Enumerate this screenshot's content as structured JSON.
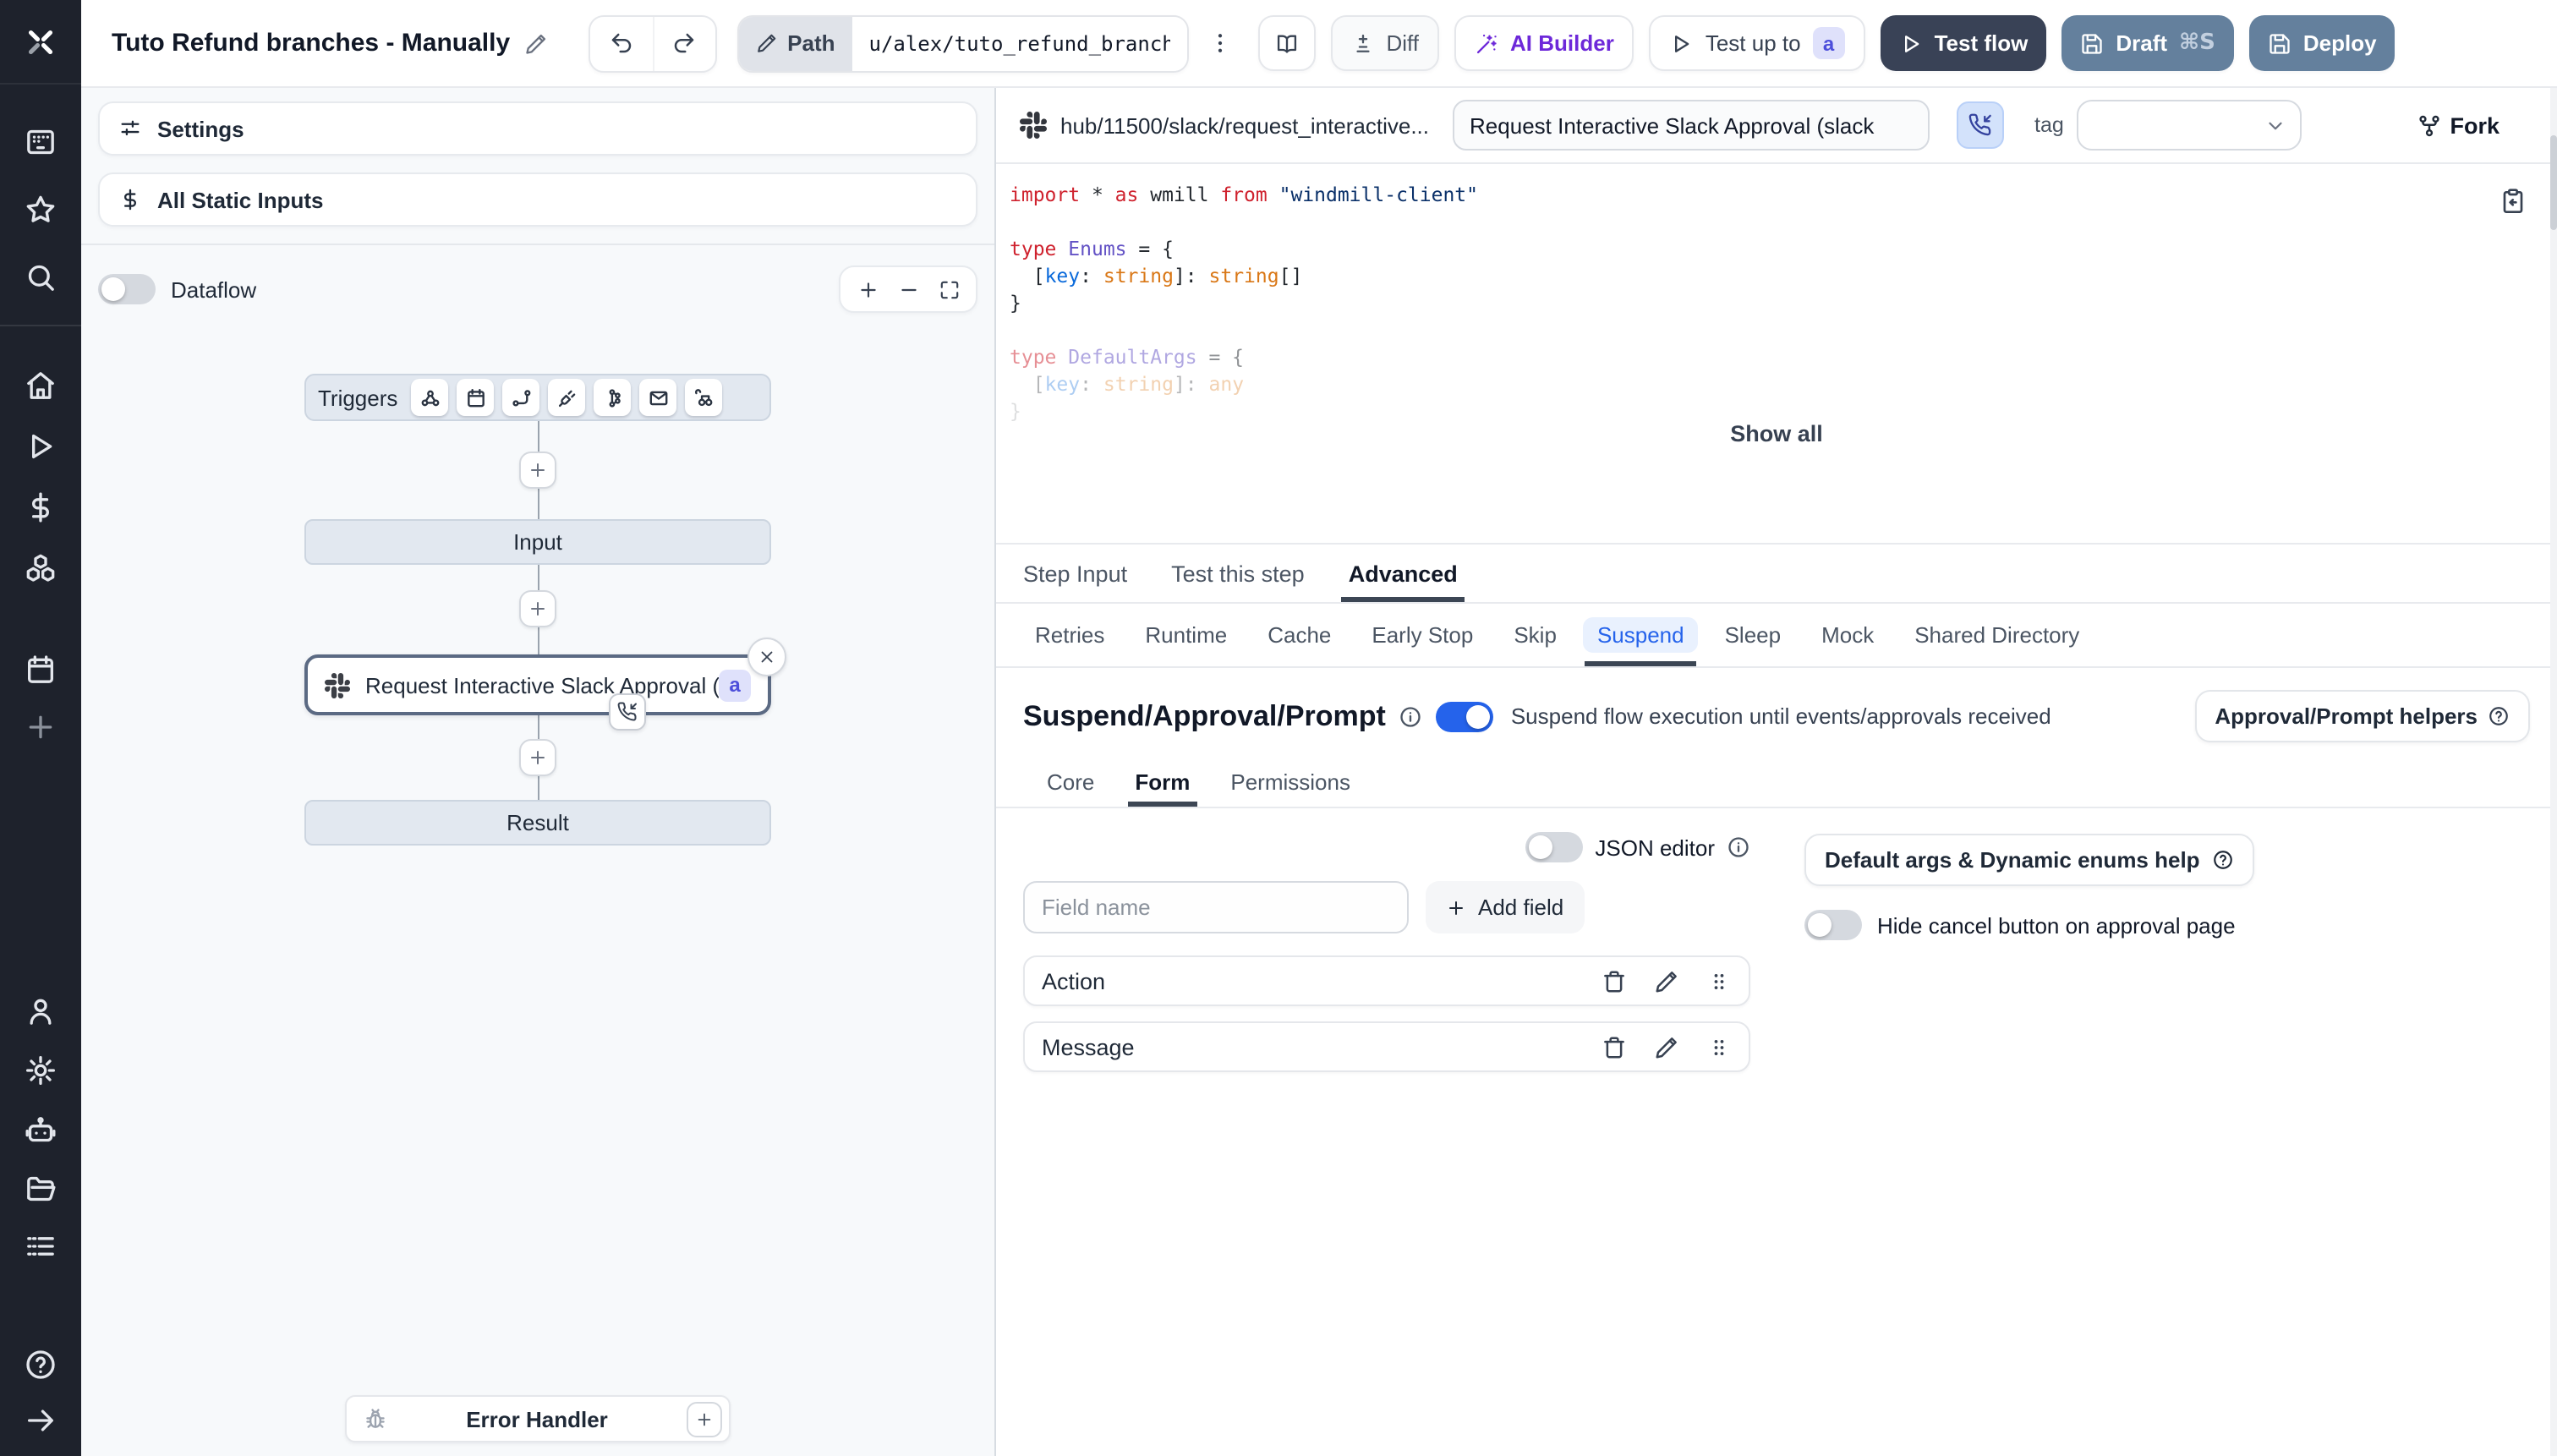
{
  "theme": {
    "rail_bg": "#1e222c",
    "accent_blue": "#2563eb",
    "navy_button": "#394256",
    "slate_button": "#64809d",
    "purple": "#6d28d9",
    "badge_indigo_text": "#4d4fdb",
    "badge_indigo_bg": "#dfe1fb"
  },
  "rail": {
    "icons": [
      "windmill-logo",
      "apps",
      "favorites",
      "search",
      "home",
      "runs",
      "variables",
      "resources",
      "schedules",
      "create",
      "user",
      "settings",
      "workers",
      "folders",
      "logs",
      "help",
      "expand-sidebar"
    ]
  },
  "topbar": {
    "title": "Tuto Refund branches - Manually",
    "path_label": "Path",
    "path_value": "u/alex/tuto_refund_branches__",
    "diff_label": "Diff",
    "ai_builder_label": "AI Builder",
    "test_up_to_label": "Test up to",
    "test_up_to_badge": "a",
    "test_flow_label": "Test flow",
    "draft_label": "Draft",
    "draft_shortcut": "⌘S",
    "deploy_label": "Deploy"
  },
  "left_panel": {
    "settings_label": "Settings",
    "static_inputs_label": "All Static Inputs",
    "dataflow_label": "Dataflow",
    "dataflow_on": false,
    "graph": {
      "triggers_label": "Triggers",
      "trigger_icons": [
        "webhook",
        "schedule",
        "http-route",
        "websocket",
        "kafka",
        "email",
        "scheduled-poll"
      ],
      "input_label": "Input",
      "step_label": "Request Interactive Slack Approval (...",
      "step_badge": "a",
      "result_label": "Result",
      "error_handler_label": "Error Handler"
    }
  },
  "step_editor": {
    "header": {
      "hub_path": "hub/11500/slack/request_interactive...",
      "summary_value": "Request Interactive Slack Approval (slack",
      "tag_label": "tag",
      "tag_value": "",
      "fork_label": "Fork"
    },
    "code": {
      "lines": [
        {
          "tokens": [
            [
              "kw",
              "import"
            ],
            [
              "pl",
              " * "
            ],
            [
              "kw",
              "as"
            ],
            [
              "pl",
              " wmill "
            ],
            [
              "kw",
              "from"
            ],
            [
              "pl",
              " "
            ],
            [
              "str",
              "\"windmill-client\""
            ]
          ]
        },
        {
          "tokens": []
        },
        {
          "tokens": [
            [
              "kw",
              "type"
            ],
            [
              "pl",
              " "
            ],
            [
              "ty",
              "Enums"
            ],
            [
              "pl",
              " = {"
            ]
          ]
        },
        {
          "tokens": [
            [
              "pl",
              "  ["
            ],
            [
              "var",
              "key"
            ],
            [
              "pl",
              ": "
            ],
            [
              "bi",
              "string"
            ],
            [
              "pl",
              "]: "
            ],
            [
              "bi",
              "string"
            ],
            [
              "pl",
              "[]"
            ]
          ]
        },
        {
          "tokens": [
            [
              "pl",
              "}"
            ]
          ]
        },
        {
          "tokens": []
        },
        {
          "opacity": 0.5,
          "tokens": [
            [
              "kw",
              "type"
            ],
            [
              "pl",
              " "
            ],
            [
              "ty",
              "DefaultArgs"
            ],
            [
              "pl",
              " = {"
            ]
          ]
        },
        {
          "opacity": 0.33,
          "tokens": [
            [
              "pl",
              "  ["
            ],
            [
              "var",
              "key"
            ],
            [
              "pl",
              ": "
            ],
            [
              "bi",
              "string"
            ],
            [
              "pl",
              "]: "
            ],
            [
              "bi",
              "any"
            ]
          ]
        },
        {
          "opacity": 0.15,
          "tokens": [
            [
              "pl",
              "}"
            ]
          ]
        }
      ]
    },
    "show_all_label": "Show all",
    "tabs": [
      "Step Input",
      "Test this step",
      "Advanced"
    ],
    "active_tab": "Advanced",
    "advanced_tabs": [
      "Retries",
      "Runtime",
      "Cache",
      "Early Stop",
      "Skip",
      "Suspend",
      "Sleep",
      "Mock",
      "Shared Directory"
    ],
    "active_advanced_tab": "Suspend",
    "suspend": {
      "heading": "Suspend/Approval/Prompt",
      "toggle_on": true,
      "toggle_text": "Suspend flow execution until events/approvals received",
      "helpers_button": "Approval/Prompt helpers",
      "tabs": [
        "Core",
        "Form",
        "Permissions"
      ],
      "active_tab": "Form",
      "form": {
        "json_editor_label": "JSON editor",
        "json_editor_on": false,
        "field_name_placeholder": "Field name",
        "add_field_label": "Add field",
        "fields": [
          {
            "name": "Action"
          },
          {
            "name": "Message"
          }
        ],
        "default_args_help_label": "Default args & Dynamic enums help",
        "hide_cancel_label": "Hide cancel button on approval page",
        "hide_cancel_on": false
      }
    }
  }
}
